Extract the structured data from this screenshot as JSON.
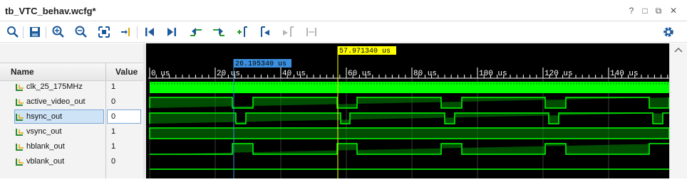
{
  "window": {
    "title": "tb_VTC_behav.wcfg*",
    "controls": {
      "help": "?",
      "restore": "□",
      "float": "⧉",
      "close": "✕"
    }
  },
  "toolbar": {
    "tools": [
      "search-icon",
      "save-icon",
      "zoom-in-icon",
      "zoom-out-icon",
      "zoom-fit-icon",
      "go-to-cursor-icon",
      "go-to-time-0-icon",
      "go-to-last-time-icon",
      "previous-transition-icon",
      "next-transition-icon",
      "add-marker-icon",
      "previous-marker-icon",
      "next-marker-icon",
      "swap-cursors-icon"
    ],
    "settings": "gear-icon"
  },
  "columns": {
    "name": "Name",
    "value": "Value"
  },
  "signals": [
    {
      "name": "clk_25_175MHz",
      "value": "1"
    },
    {
      "name": "active_video_out",
      "value": "0"
    },
    {
      "name": "hsync_out",
      "value": "0",
      "selected": true
    },
    {
      "name": "vsync_out",
      "value": "1"
    },
    {
      "name": "hblank_out",
      "value": "1"
    },
    {
      "name": "vblank_out",
      "value": "0"
    }
  ],
  "timeline": {
    "ticks": [
      "0 us",
      "20 us",
      "40 us",
      "60 us",
      "80 us",
      "100 us",
      "120 us",
      "140 us"
    ],
    "primary_cursor": "57.971340 us",
    "secondary_cursor": "26.195340 us"
  },
  "colors": {
    "wave": "#00ff00",
    "cursor_yellow": "#ffff00",
    "cursor_blue": "#3b8fde",
    "background": "#000000",
    "grid": "#3c3c3c"
  }
}
